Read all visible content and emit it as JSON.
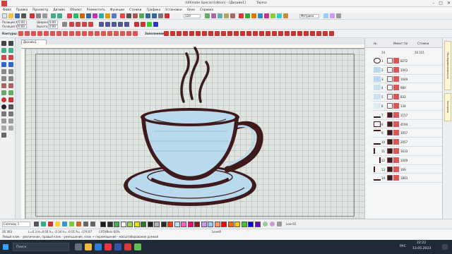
{
  "title_bar": {
    "title": "(Ultimate Special Edition) - [Дизайн1]",
    "user": "Tajima",
    "controls": [
      "–",
      "□",
      "✕"
    ]
  },
  "menu": [
    "Файл",
    "Правка",
    "Просмотр",
    "Дизайн",
    "Объект",
    "Разместить",
    "Функции",
    "Стежки",
    "Графика",
    "Установки",
    "Окно",
    "Справка"
  ],
  "toolbar1": {
    "zoom_value": "120",
    "units_value": "Метрика"
  },
  "toolbar2": {
    "pos_x_label": "Позиция X:",
    "pos_y_label": "Позиция Y:",
    "pos_x_value": "0.00",
    "pos_y_value": "0.00",
    "width_label": "Ширина:",
    "height_label": "Высота:",
    "width_value": "0.00",
    "height_value": "0.00"
  },
  "toolbar3": {
    "outlines_label": "Контуры:",
    "fill_label": "Заполнение:"
  },
  "document_tab": "Дизайн1",
  "right_panel": {
    "header_cols": [
      "№",
      "Имект тоr",
      "Стежки"
    ],
    "summary_num": "14",
    "summary_stitches": "26 221",
    "rows": [
      {
        "n": "1",
        "stitches": "8272"
      },
      {
        "n": "2",
        "stitches": "1043"
      },
      {
        "n": "3",
        "stitches": "1049"
      },
      {
        "n": "4",
        "stitches": "980"
      },
      {
        "n": "5",
        "stitches": "832"
      },
      {
        "n": "6",
        "stitches": "134"
      },
      {
        "n": "7",
        "stitches": "1157"
      },
      {
        "n": "8",
        "stitches": "4194"
      },
      {
        "n": "9",
        "stitches": "1057"
      },
      {
        "n": "10",
        "stitches": "2057"
      },
      {
        "n": "11",
        "stitches": "1633"
      },
      {
        "n": "12",
        "stitches": "1049"
      },
      {
        "n": "13",
        "stitches": "169"
      },
      {
        "n": "14",
        "stitches": "1893"
      }
    ]
  },
  "side_tabs": [
    "Последовательность",
    "Контроль"
  ],
  "bottom_bar": {
    "colorway": "Colorway 1",
    "swatches": [
      "#1a1a1a",
      "#2e2e2e",
      "#3cb44b",
      "#f2f2f2",
      "#9bd34b",
      "#e6e600",
      "#2a7a2a",
      "#222222",
      "#b0b0b0",
      "#2a2a2a",
      "#ff3300",
      "#c0e0ff",
      "#ff66cc",
      "#ff0066",
      "#8a1a1a",
      "#cc99ff",
      "#99ccff",
      "#ff9966",
      "#ff0000",
      "#ff6600",
      "#ffcc00",
      "#33cc33",
      "#0000ff",
      "#6600cc"
    ],
    "zoom_label": "Low 65"
  },
  "status": {
    "coords": "26 363",
    "info": "L=0.3 H=0.04 h= -0.34 h= -0.01 A= -174.67",
    "stitch_info": "CATHRein 60%",
    "hint": "Левый клик - увеличение, правый клик - уменьшение, клик + перемещение - масштабирование рамкой",
    "zoom": "Level0"
  },
  "taskbar": {
    "search": "Поиск",
    "lang": "РУС",
    "time": "22:22",
    "date": "13.05.2023"
  },
  "colors": {
    "cup_fill": "#b9d9ec",
    "outline": "#3f1a1c",
    "steam": "#3a1e1e"
  }
}
